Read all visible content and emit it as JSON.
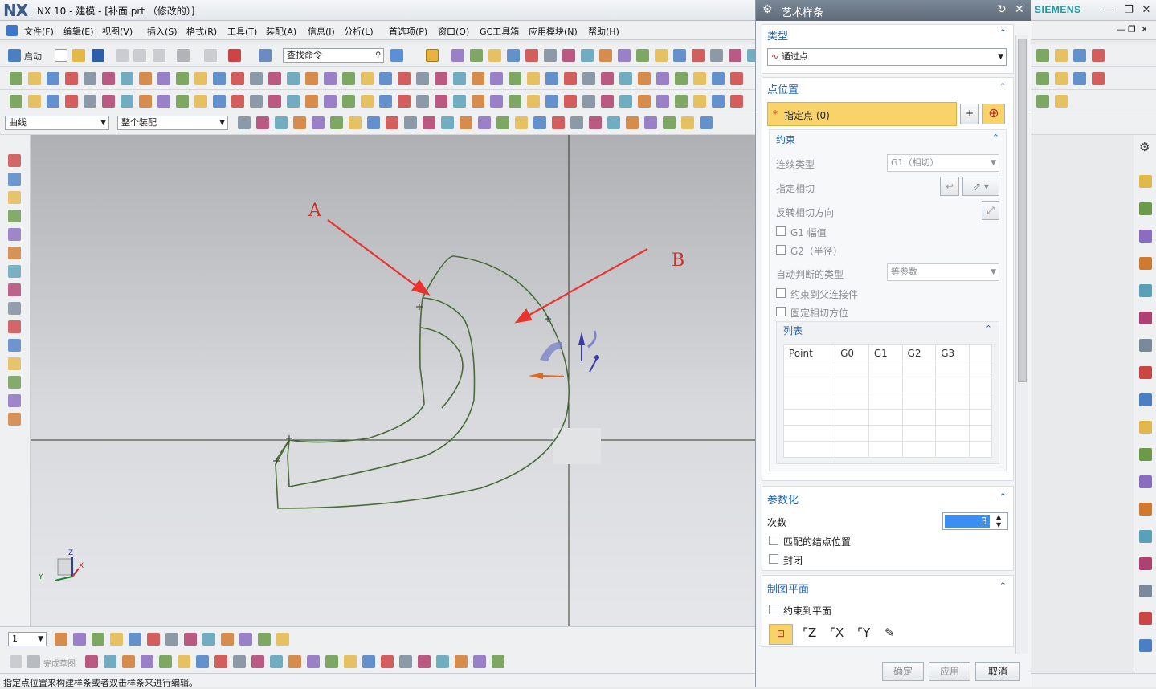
{
  "window": {
    "logo": "NX",
    "title": "NX 10 - 建模 - [补面.prt （修改的）]",
    "brand": "SIEMENS"
  },
  "menu": [
    "文件(F)",
    "编辑(E)",
    "视图(V)",
    "插入(S)",
    "格式(R)",
    "工具(T)",
    "装配(A)",
    "信息(I)",
    "分析(L)",
    "首选项(P)",
    "窗口(O)",
    "GC工具箱",
    "应用模块(N)",
    "帮助(H)"
  ],
  "toolbar": {
    "start_label": "启动",
    "search_placeholder": "查找命令",
    "filter_select": "曲线",
    "scope_select": "整个装配"
  },
  "graphics": {
    "label_a": "A",
    "label_b": "B",
    "triad": {
      "z": "Z",
      "y": "Y",
      "x": "X"
    }
  },
  "bottom": {
    "layer_select": "1",
    "finish_sketch": "完成草图"
  },
  "status": "指定点位置来构建样条或者双击样条来进行编辑。",
  "dialog": {
    "title": "艺术样条",
    "type_header": "类型",
    "type_value": "通过点",
    "point_header": "点位置",
    "specify_point": "指定点 (0)",
    "constraint_header": "约束",
    "continuity_label": "连续类型",
    "continuity_value": "G1（相切）",
    "tangent_label": "指定相切",
    "reverse_label": "反转相切方向",
    "g1_label": "G1 幅值",
    "g2_label": "G2（半径）",
    "auto_type_label": "自动判断的类型",
    "auto_type_value": "等参数",
    "constrain_parent_label": "约束到父连接件",
    "fix_tangent_label": "固定相切方位",
    "list_header": "列表",
    "columns": [
      "Point",
      "G0",
      "G1",
      "G2",
      "G3"
    ],
    "param_header": "参数化",
    "degree_label": "次数",
    "degree_value": "3",
    "match_knot_label": "匹配的结点位置",
    "closed_label": "封闭",
    "plane_header": "制图平面",
    "constrain_plane_label": "约束到平面",
    "ok": "确定",
    "apply": "应用",
    "cancel": "取消"
  },
  "colors": {
    "curve": "#4a6b3a",
    "arrow": "#e8332e",
    "selected_row": "#f8d36a",
    "accent_blue": "#1f62b3"
  }
}
